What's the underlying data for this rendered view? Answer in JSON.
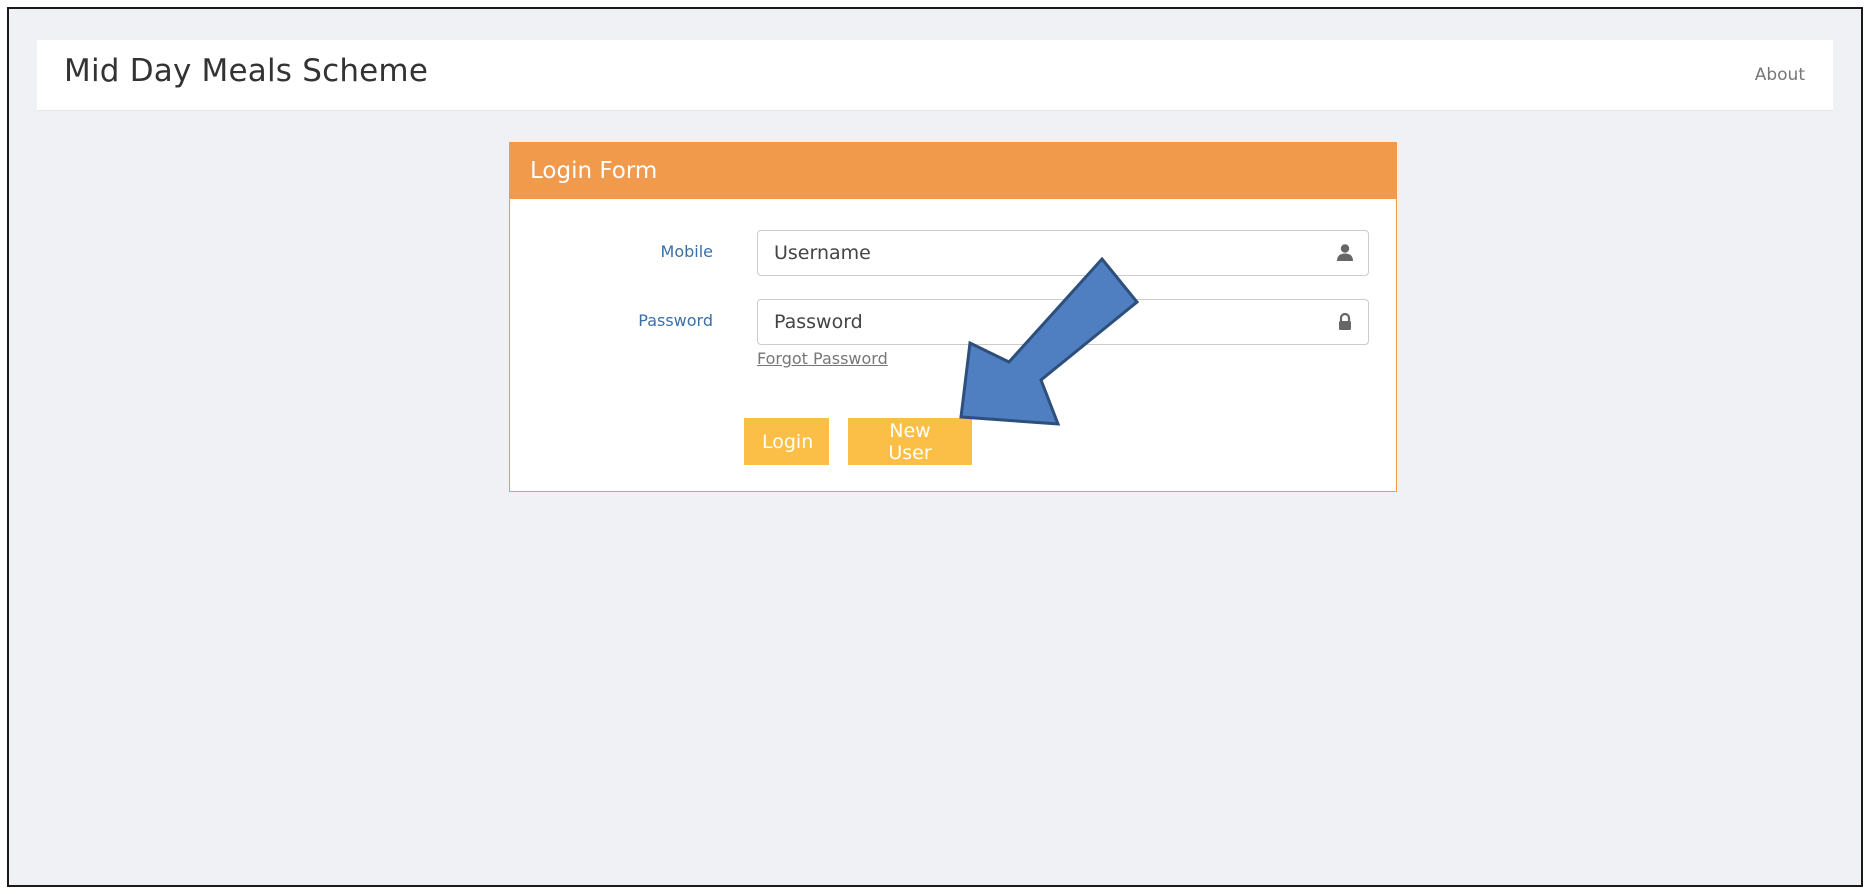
{
  "header": {
    "brand": "Mid Day Meals Scheme",
    "about_label": "About"
  },
  "login_form": {
    "title": "Login Form",
    "mobile_label": "Mobile",
    "username_placeholder": "Username",
    "password_label": "Password",
    "password_placeholder": "Password",
    "forgot_password_label": "Forgot Password",
    "login_button_label": "Login",
    "new_user_button_label": "New User",
    "username_icon": "user-icon",
    "password_icon": "lock-icon"
  },
  "annotation": {
    "arrow_icon": "arrow-pointer-icon",
    "arrow_color": "#4f7fc0"
  },
  "colors": {
    "panel_heading": "#f29a4c",
    "button": "#fbbf47",
    "label": "#3a6fa8",
    "page_background": "#f0f1f5"
  }
}
